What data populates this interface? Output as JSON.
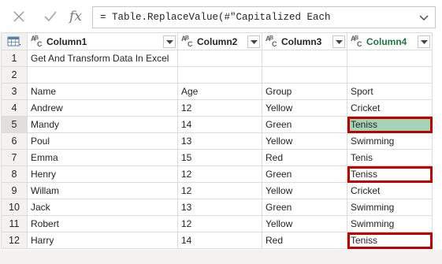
{
  "formula_bar": {
    "cancel_icon": "close-icon",
    "confirm_icon": "check-icon",
    "fx_label": "fx",
    "formula": "= Table.ReplaceValue(#\"Capitalized Each",
    "expand_icon": "chevron-down-icon"
  },
  "columns": [
    {
      "name": "Column1",
      "type_icon": "text-type-icon"
    },
    {
      "name": "Column2",
      "type_icon": "text-type-icon"
    },
    {
      "name": "Column3",
      "type_icon": "text-type-icon"
    },
    {
      "name": "Column4",
      "type_icon": "text-type-icon",
      "active": true
    }
  ],
  "rows": [
    {
      "n": "1",
      "c1": "Get And Transform Data In Excel",
      "c2": "",
      "c3": "",
      "c4": ""
    },
    {
      "n": "2",
      "c1": "",
      "c2": "",
      "c3": "",
      "c4": ""
    },
    {
      "n": "3",
      "c1": "Name",
      "c2": "Age",
      "c3": "Group",
      "c4": "Sport"
    },
    {
      "n": "4",
      "c1": "Andrew",
      "c2": "12",
      "c3": "Yellow",
      "c4": "Cricket"
    },
    {
      "n": "5",
      "c1": "Mandy",
      "c2": "14",
      "c3": "Green",
      "c4": "Teniss",
      "selected": true,
      "boxed": true
    },
    {
      "n": "6",
      "c1": "Poul",
      "c2": "13",
      "c3": "Yellow",
      "c4": "Swimming"
    },
    {
      "n": "7",
      "c1": "Emma",
      "c2": "15",
      "c3": "Red",
      "c4": "Tenis"
    },
    {
      "n": "8",
      "c1": "Henry",
      "c2": "12",
      "c3": "Green",
      "c4": "Teniss",
      "boxed": true
    },
    {
      "n": "9",
      "c1": "Willam",
      "c2": "12",
      "c3": "Yellow",
      "c4": "Cricket"
    },
    {
      "n": "10",
      "c1": "Jack",
      "c2": "13",
      "c3": "Green",
      "c4": "Swimming"
    },
    {
      "n": "11",
      "c1": "Robert",
      "c2": "12",
      "c3": "Yellow",
      "c4": "Swimming"
    },
    {
      "n": "12",
      "c1": "Harry",
      "c2": "14",
      "c3": "Red",
      "c4": "Teniss",
      "boxed": true
    }
  ],
  "colors": {
    "active_header": "#217346",
    "selected_cell": "#a3d4b5",
    "highlight_box": "#c00000"
  }
}
